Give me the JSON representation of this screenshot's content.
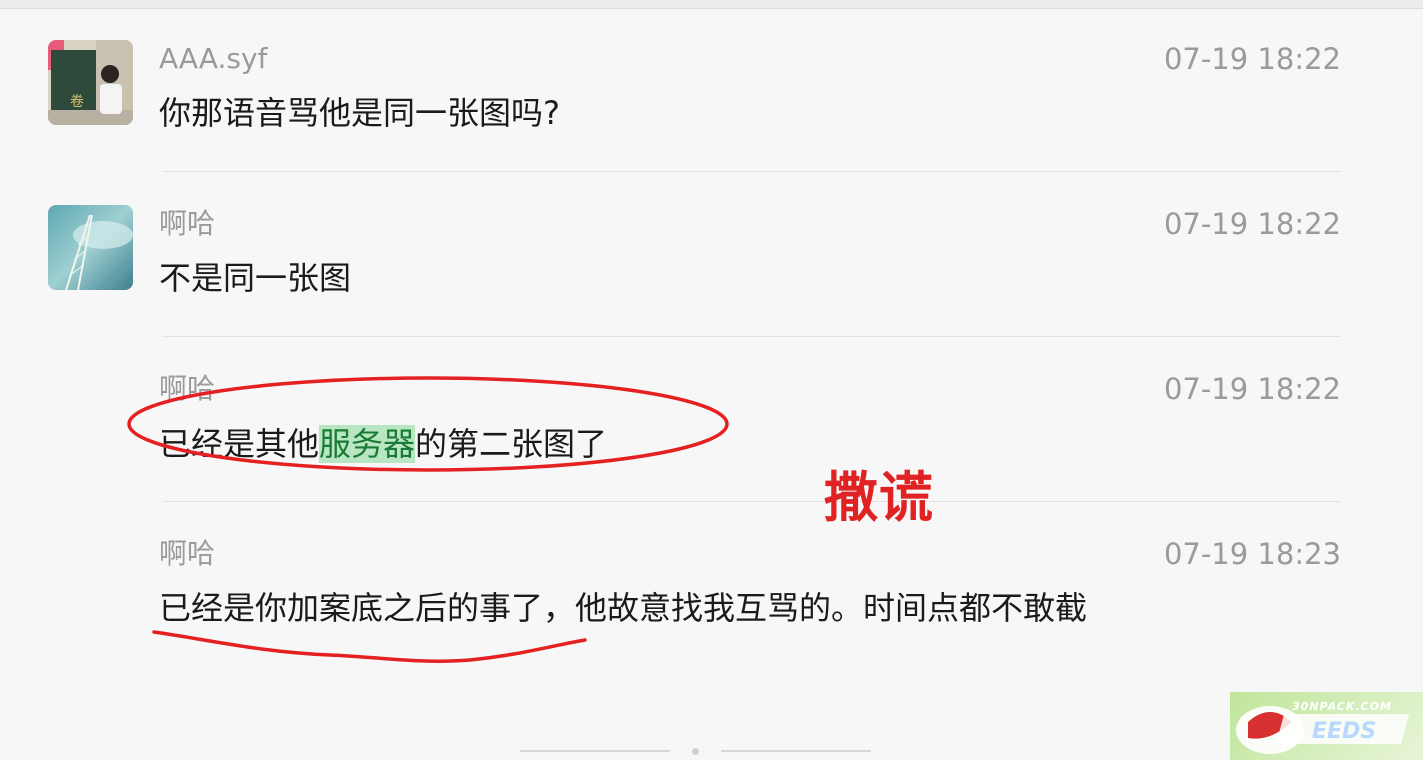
{
  "messages": [
    {
      "sender": "AAA.syf",
      "time": "07-19 18:22",
      "text": "你那语音骂他是同一张图吗?"
    },
    {
      "sender": "啊哈",
      "time": "07-19 18:22",
      "text": "不是同一张图"
    },
    {
      "sender": "啊哈",
      "time": "07-19 18:22",
      "text_before": "已经是其他",
      "text_highlight": "服务器",
      "text_after": "的第二张图了"
    },
    {
      "sender": "啊哈",
      "time": "07-19 18:23",
      "text": "已经是你加案底之后的事了，他故意找我互骂的。时间点都不敢截"
    }
  ],
  "annotation": {
    "label": "撒谎",
    "color": "#e02222"
  },
  "watermark": {
    "text": "30NPACK.COM",
    "color": "#bfe59a"
  },
  "highlight_color": "#b8e6c2"
}
